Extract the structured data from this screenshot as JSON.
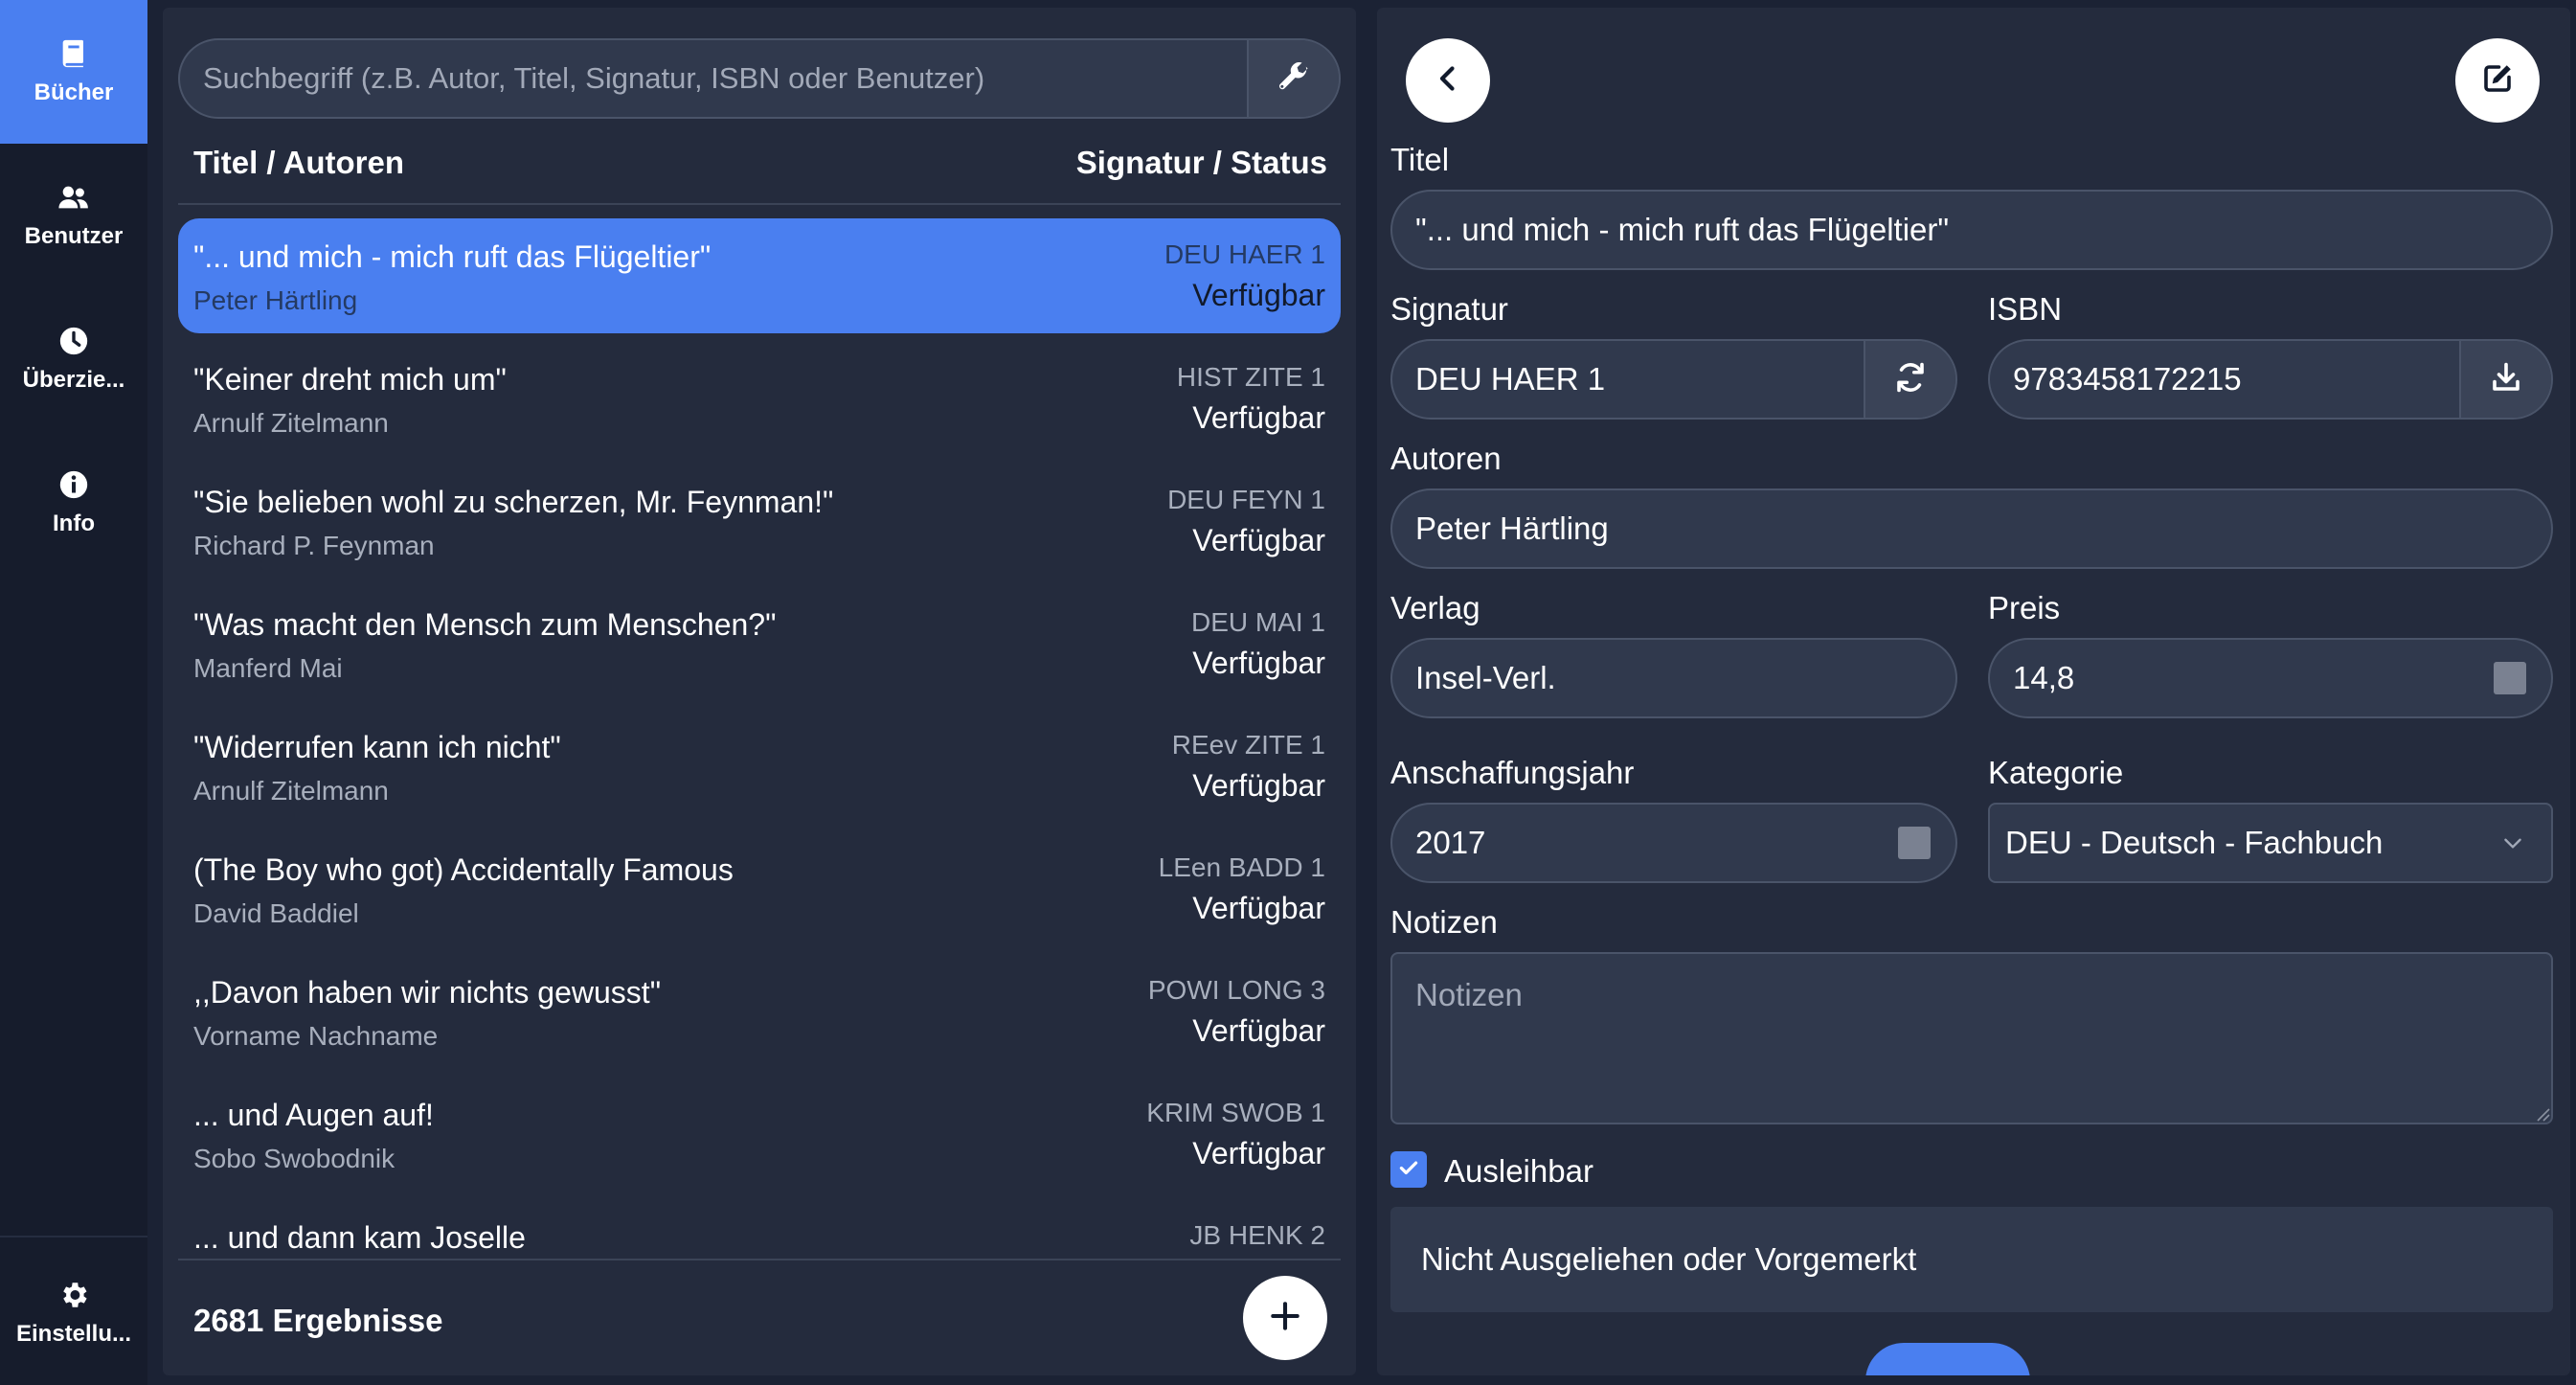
{
  "sidebar": {
    "items": [
      {
        "label": "Bücher",
        "icon": "book-icon",
        "active": true
      },
      {
        "label": "Benutzer",
        "icon": "users-icon",
        "active": false
      },
      {
        "label": "Überzie...",
        "icon": "clock-icon",
        "active": false
      },
      {
        "label": "Info",
        "icon": "info-icon",
        "active": false
      }
    ],
    "settings": {
      "label": "Einstellu...",
      "icon": "gear-icon"
    }
  },
  "list": {
    "search_placeholder": "Suchbegriff (z.B. Autor, Titel, Signatur, ISBN oder Benutzer)",
    "search_tool_icon": "wrench-icon",
    "header_left": "Titel / Autoren",
    "header_right": "Signatur / Status",
    "items": [
      {
        "title": "\"... und mich - mich ruft das Flügeltier\"",
        "author": "Peter Härtling",
        "signature": "DEU HAER 1",
        "status": "Verfügbar",
        "selected": true
      },
      {
        "title": "\"Keiner dreht mich um\"",
        "author": "Arnulf Zitelmann",
        "signature": "HIST ZITE 1",
        "status": "Verfügbar",
        "selected": false
      },
      {
        "title": "\"Sie belieben wohl zu scherzen, Mr. Feynman!\"",
        "author": "Richard P. Feynman",
        "signature": "DEU FEYN 1",
        "status": "Verfügbar",
        "selected": false
      },
      {
        "title": "\"Was macht den Mensch zum Menschen?\"",
        "author": "Manferd Mai",
        "signature": "DEU MAI 1",
        "status": "Verfügbar",
        "selected": false
      },
      {
        "title": "\"Widerrufen kann ich nicht\"",
        "author": "Arnulf Zitelmann",
        "signature": "REev ZITE 1",
        "status": "Verfügbar",
        "selected": false
      },
      {
        "title": "(The Boy who got) Accidentally Famous",
        "author": "David Baddiel",
        "signature": "LEen BADD 1",
        "status": "Verfügbar",
        "selected": false
      },
      {
        "title": ",,Davon haben wir nichts gewusst\"",
        "author": "Vorname Nachname",
        "signature": "POWI LONG 3",
        "status": "Verfügbar",
        "selected": false
      },
      {
        "title": "... und Augen auf!",
        "author": "Sobo Swobodnik",
        "signature": "KRIM SWOB 1",
        "status": "Verfügbar",
        "selected": false
      },
      {
        "title": "... und dann kam Joselle",
        "author": "",
        "signature": "JB HENK 2",
        "status": "",
        "selected": false
      }
    ],
    "result_count": "2681 Ergebnisse"
  },
  "detail": {
    "labels": {
      "title": "Titel",
      "signature": "Signatur",
      "isbn": "ISBN",
      "authors": "Autoren",
      "publisher": "Verlag",
      "price": "Preis",
      "year": "Anschaffungsjahr",
      "category": "Kategorie",
      "notes": "Notizen"
    },
    "values": {
      "title": "\"... und mich - mich ruft das Flügeltier\"",
      "signature": "DEU HAER 1",
      "isbn": "9783458172215",
      "authors": "Peter Härtling",
      "publisher": "Insel-Verl.",
      "price": "14,8",
      "year": "2017",
      "category": "DEU - Deutsch - Fachbuch"
    },
    "notes_placeholder": "Notizen",
    "lendable_label": "Ausleihbar",
    "lendable_checked": true,
    "status_text": "Nicht Ausgeliehen oder Vorgemerkt"
  },
  "colors": {
    "accent": "#4a7ff0",
    "background": "#1b2234",
    "panel": "#242b3d",
    "input": "#30394d"
  }
}
